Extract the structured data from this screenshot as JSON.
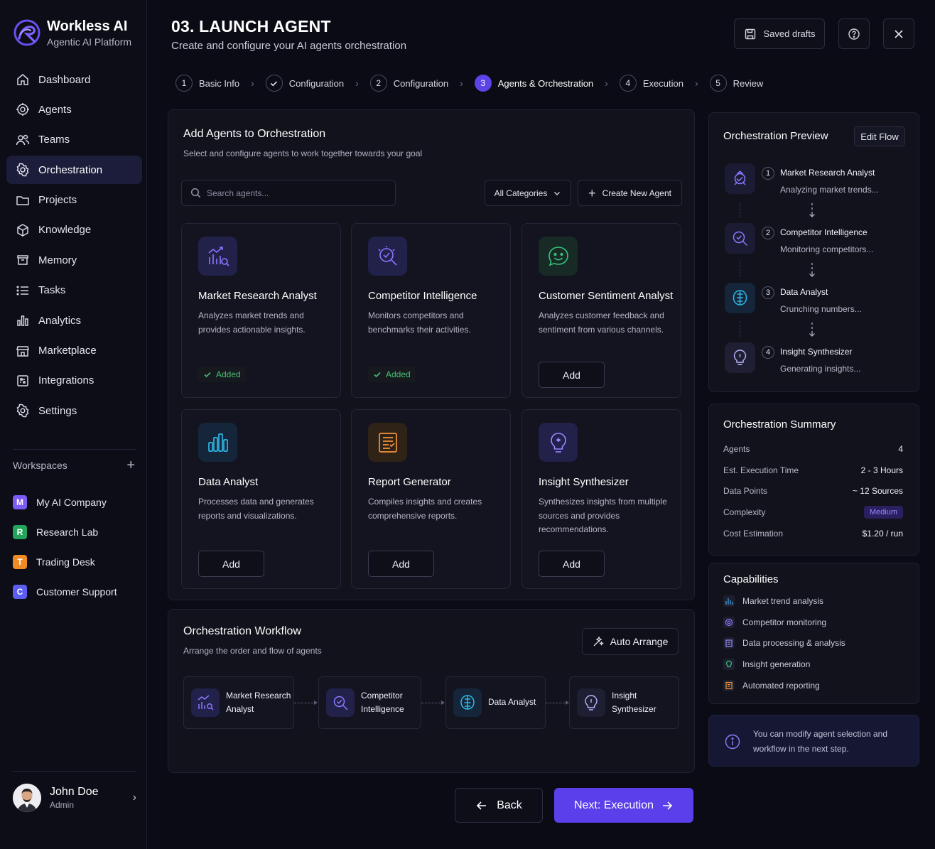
{
  "brand": {
    "name": "Workless AI",
    "subtitle": "Agentic AI Platform"
  },
  "nav": [
    {
      "label": "Dashboard",
      "icon": "home-icon"
    },
    {
      "label": "Agents",
      "icon": "agents-icon"
    },
    {
      "label": "Teams",
      "icon": "users-icon"
    },
    {
      "label": "Orchestration",
      "icon": "orchestration-icon",
      "active": true
    },
    {
      "label": "Projects",
      "icon": "folder-icon"
    },
    {
      "label": "Knowledge",
      "icon": "knowledge-icon"
    },
    {
      "label": "Memory",
      "icon": "memory-icon"
    },
    {
      "label": "Tasks",
      "icon": "list-icon"
    },
    {
      "label": "Analytics",
      "icon": "bar-chart-icon"
    },
    {
      "label": "Marketplace",
      "icon": "store-icon"
    },
    {
      "label": "Integrations",
      "icon": "integrations-icon"
    },
    {
      "label": "Settings",
      "icon": "gear-icon"
    }
  ],
  "workspaces": {
    "title": "Workspaces",
    "items": [
      {
        "letter": "M",
        "label": "My AI Company",
        "color": "#7c5cf5"
      },
      {
        "letter": "R",
        "label": "Research Lab",
        "color": "#22a55b"
      },
      {
        "letter": "T",
        "label": "Trading Desk",
        "color": "#f08a24"
      },
      {
        "letter": "C",
        "label": "Customer Support",
        "color": "#5b5ef0"
      }
    ]
  },
  "user": {
    "name": "John Doe",
    "role": "Admin"
  },
  "header": {
    "title": "03. LAUNCH AGENT",
    "subtitle": "Create and configure your AI agents orchestration",
    "saved_drafts": "Saved drafts"
  },
  "steps": [
    {
      "num": "1",
      "label": "Basic Info",
      "state": "pending"
    },
    {
      "num": "",
      "label": "Configuration",
      "state": "done"
    },
    {
      "num": "2",
      "label": "Configuration",
      "state": "pending"
    },
    {
      "num": "3",
      "label": "Agents & Orchestration",
      "state": "active"
    },
    {
      "num": "4",
      "label": "Execution",
      "state": "pending"
    },
    {
      "num": "5",
      "label": "Review",
      "state": "pending"
    }
  ],
  "add_agents": {
    "title": "Add Agents to Orchestration",
    "subtitle": "Select and configure agents to work together towards your goal",
    "search_placeholder": "Search agents...",
    "category": "All Categories",
    "create_label": "Create New Agent",
    "added_label": "Added",
    "add_label": "Add",
    "cards": [
      {
        "title": "Market Research Analyst",
        "desc": "Analyzes market trends and provides actionable insights.",
        "added": true
      },
      {
        "title": "Competitor Intelligence",
        "desc": "Monitors competitors and benchmarks their activities.",
        "added": true
      },
      {
        "title": "Customer Sentiment Analyst",
        "desc": "Analyzes customer feedback and sentiment from various channels.",
        "added": false
      },
      {
        "title": "Data Analyst",
        "desc": "Processes data and generates reports and visualizations.",
        "added": false
      },
      {
        "title": "Report Generator",
        "desc": "Compiles insights and creates comprehensive reports.",
        "added": false
      },
      {
        "title": "Insight Synthesizer",
        "desc": "Synthesizes insights from multiple sources and provides recommendations.",
        "added": false
      }
    ]
  },
  "workflow": {
    "title": "Orchestration Workflow",
    "subtitle": "Arrange the order and flow of agents",
    "auto_arrange": "Auto Arrange",
    "nodes": [
      {
        "line1": "Market Research",
        "line2": "Analyst"
      },
      {
        "line1": "Competitor",
        "line2": "Intelligence"
      },
      {
        "line1": "Data Analyst",
        "line2": ""
      },
      {
        "line1": "Insight",
        "line2": "Synthesizer"
      }
    ]
  },
  "preview": {
    "title": "Orchestration Preview",
    "edit_label": "Edit Flow",
    "items": [
      {
        "num": "1",
        "name": "Market Research Analyst",
        "status": "Analyzing market trends..."
      },
      {
        "num": "2",
        "name": "Competitor Intelligence",
        "status": "Monitoring competitors..."
      },
      {
        "num": "3",
        "name": "Data Analyst",
        "status": "Crunching numbers..."
      },
      {
        "num": "4",
        "name": "Insight Synthesizer",
        "status": "Generating insights..."
      }
    ]
  },
  "summary": {
    "title": "Orchestration Summary",
    "rows": [
      {
        "key": "Agents",
        "value": "4"
      },
      {
        "key": "Est. Execution Time",
        "value": "2 - 3 Hours"
      },
      {
        "key": "Data Points",
        "value": "~ 12 Sources"
      },
      {
        "key": "Complexity",
        "value": "Medium"
      },
      {
        "key": "Cost Estimation",
        "value": "$1.20 / run"
      }
    ]
  },
  "capabilities": {
    "title": "Capabilities",
    "items": [
      "Market trend analysis",
      "Competitor monitoring",
      "Data processing & analysis",
      "Insight generation",
      "Automated reporting"
    ]
  },
  "note": {
    "text": "You can modify agent selection and workflow in the next step."
  },
  "footer": {
    "back": "Back",
    "next": "Next: Execution"
  },
  "colors": {
    "accent": "#5b3fea",
    "success": "#49c074",
    "panel": "#11121c"
  }
}
